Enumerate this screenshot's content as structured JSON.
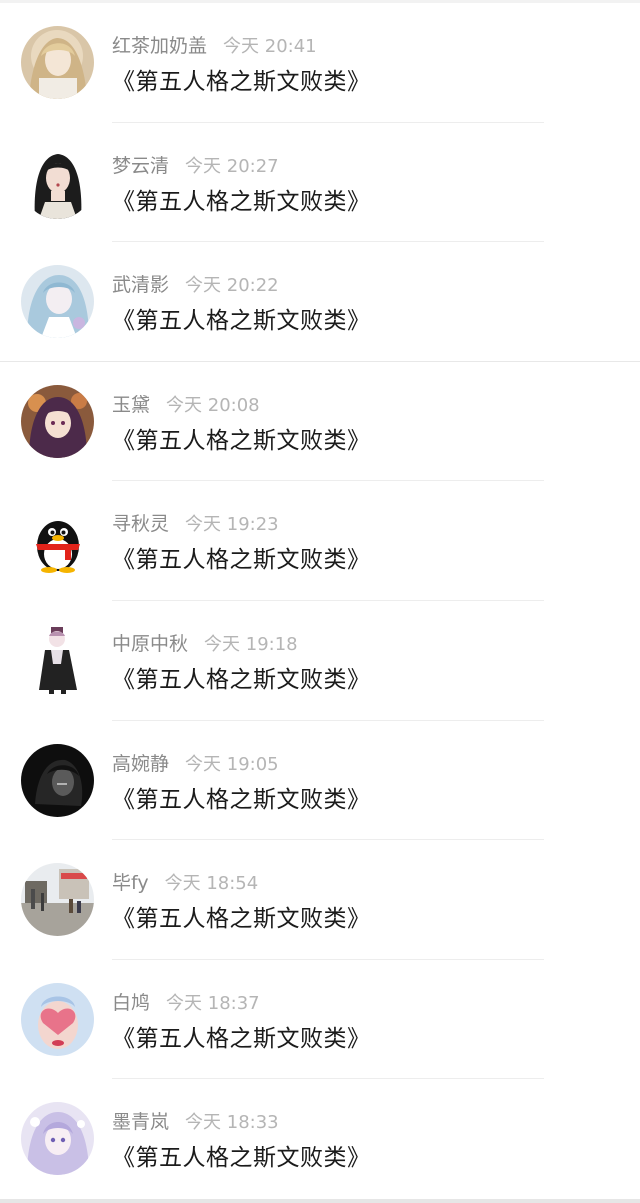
{
  "comments": [
    {
      "name": "红茶加奶盖",
      "time": "今天 20:41",
      "text": "《第五人格之斯文败类》",
      "avatar": "blonde-anime-girl-avatar"
    },
    {
      "name": "梦云清",
      "time": "今天 20:27",
      "text": "《第五人格之斯文败类》",
      "avatar": "dark-hair-woman-avatar"
    },
    {
      "name": "武清影",
      "time": "今天 20:22",
      "text": "《第五人格之斯文败类》",
      "avatar": "light-blue-anime-avatar"
    },
    {
      "name": "玉黛",
      "time": "今天 20:08",
      "text": "《第五人格之斯文败类》",
      "avatar": "purple-hair-anime-avatar"
    },
    {
      "name": "寻秋灵",
      "time": "今天 19:23",
      "text": "《第五人格之斯文败类》",
      "avatar": "qq-penguin-avatar"
    },
    {
      "name": "中原中秋",
      "time": "今天 19:18",
      "text": "《第五人格之斯文败类》",
      "avatar": "chibi-character-avatar"
    },
    {
      "name": "高婉静",
      "time": "今天 19:05",
      "text": "《第五人格之斯文败类》",
      "avatar": "dark-anime-avatar"
    },
    {
      "name": "毕fy",
      "time": "今天 18:54",
      "text": "《第五人格之斯文败类》",
      "avatar": "street-photo-avatar"
    },
    {
      "name": "白鸠",
      "time": "今天 18:37",
      "text": "《第五人格之斯文败类》",
      "avatar": "heart-hands-avatar"
    },
    {
      "name": "墨青岚",
      "time": "今天 18:33",
      "text": "《第五人格之斯文败类》",
      "avatar": "lavender-anime-avatar"
    }
  ]
}
